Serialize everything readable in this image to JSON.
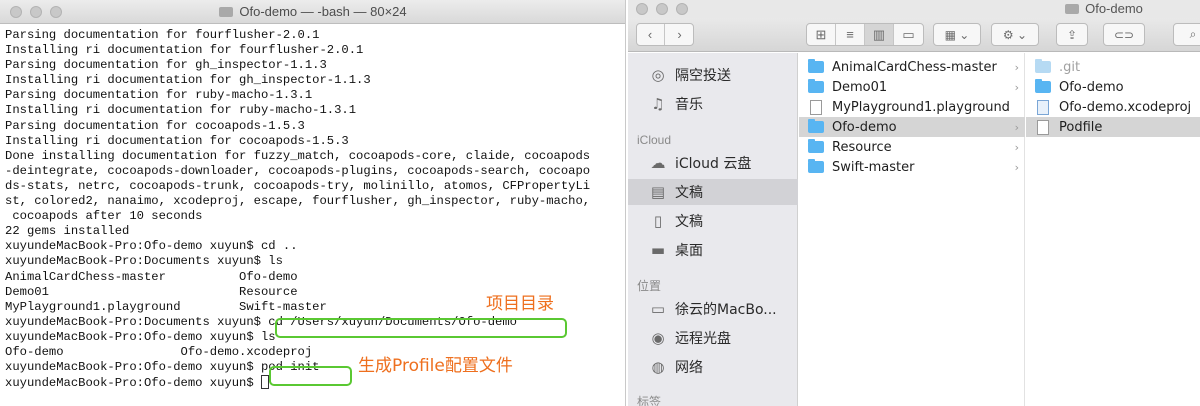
{
  "terminal": {
    "title": "Ofo-demo — -bash — 80×24",
    "lines": [
      "Parsing documentation for fourflusher-2.0.1",
      "Installing ri documentation for fourflusher-2.0.1",
      "Parsing documentation for gh_inspector-1.1.3",
      "Installing ri documentation for gh_inspector-1.1.3",
      "Parsing documentation for ruby-macho-1.3.1",
      "Installing ri documentation for ruby-macho-1.3.1",
      "Parsing documentation for cocoapods-1.5.3",
      "Installing ri documentation for cocoapods-1.5.3",
      "Done installing documentation for fuzzy_match, cocoapods-core, claide, cocoapods",
      "-deintegrate, cocoapods-downloader, cocoapods-plugins, cocoapods-search, cocoapo",
      "ds-stats, netrc, cocoapods-trunk, cocoapods-try, molinillo, atomos, CFPropertyLi",
      "st, colored2, nanaimo, xcodeproj, escape, fourflusher, gh_inspector, ruby-macho,",
      " cocoapods after 10 seconds",
      "22 gems installed",
      "xuyundeMacBook-Pro:Ofo-demo xuyun$ cd ..",
      "xuyundeMacBook-Pro:Documents xuyun$ ls",
      "AnimalCardChess-master          Ofo-demo",
      "Demo01                          Resource",
      "MyPlayground1.playground        Swift-master",
      "xuyundeMacBook-Pro:Documents xuyun$ cd /Users/xuyun/Documents/Ofo-demo",
      "xuyundeMacBook-Pro:Ofo-demo xuyun$ ls",
      "Ofo-demo                Ofo-demo.xcodeproj",
      "xuyundeMacBook-Pro:Ofo-demo xuyun$ pod init",
      "xuyundeMacBook-Pro:Ofo-demo xuyun$ "
    ],
    "annotation_project_dir": "项目目录",
    "annotation_podfile": "生成Profile配置文件"
  },
  "finder": {
    "title": "Ofo-demo",
    "sidebar": {
      "favorites": [
        {
          "label": "隔空投送",
          "icon": "airdrop-icon"
        },
        {
          "label": "音乐",
          "icon": "music-icon"
        }
      ],
      "icloud_header": "iCloud",
      "icloud": [
        {
          "label": "iCloud 云盘",
          "icon": "cloud-icon"
        },
        {
          "label": "文稿",
          "icon": "documents-icon"
        },
        {
          "label": "文稿",
          "icon": "document-icon"
        },
        {
          "label": "桌面",
          "icon": "desktop-icon"
        }
      ],
      "locations_header": "位置",
      "locations": [
        {
          "label": "徐云的MacBo...",
          "icon": "laptop-icon"
        },
        {
          "label": "远程光盘",
          "icon": "disc-icon"
        },
        {
          "label": "网络",
          "icon": "network-icon"
        }
      ],
      "tags_header": "标签"
    },
    "column1": [
      "AnimalCardChess-master",
      "Demo01",
      "MyPlayground1.playground",
      "Ofo-demo",
      "Resource",
      "Swift-master"
    ],
    "column2": [
      ".git",
      "Ofo-demo",
      "Ofo-demo.xcodeproj",
      "Podfile"
    ]
  }
}
